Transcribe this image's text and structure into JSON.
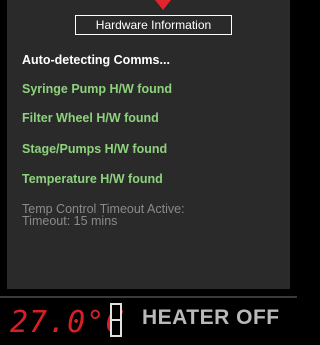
{
  "header": {
    "title": "Hardware Information"
  },
  "messages": {
    "detecting": "Auto-detecting Comms...",
    "syringe_pump": "Syringe Pump H/W found",
    "filter_wheel": "Filter Wheel H/W found",
    "stage_pumps": "Stage/Pumps H/W found",
    "temperature": "Temperature H/W found",
    "timeout_line1": "Temp Control Timeout Active:",
    "timeout_line2": "Timeout: 15 mins"
  },
  "status_bar": {
    "temperature_readout": "27.0°C",
    "heater_status": "HEATER OFF"
  },
  "colors": {
    "background": "#000000",
    "panel": "#2a2a2a",
    "success_text": "#8ed27e",
    "disabled_text": "#8a8a8a",
    "temperature_red": "#d81f26",
    "marker_red": "#e3242b"
  },
  "icons": {
    "top_marker": "red-triangle-down-icon",
    "heater_indicator": "heater-indicator-icon"
  }
}
